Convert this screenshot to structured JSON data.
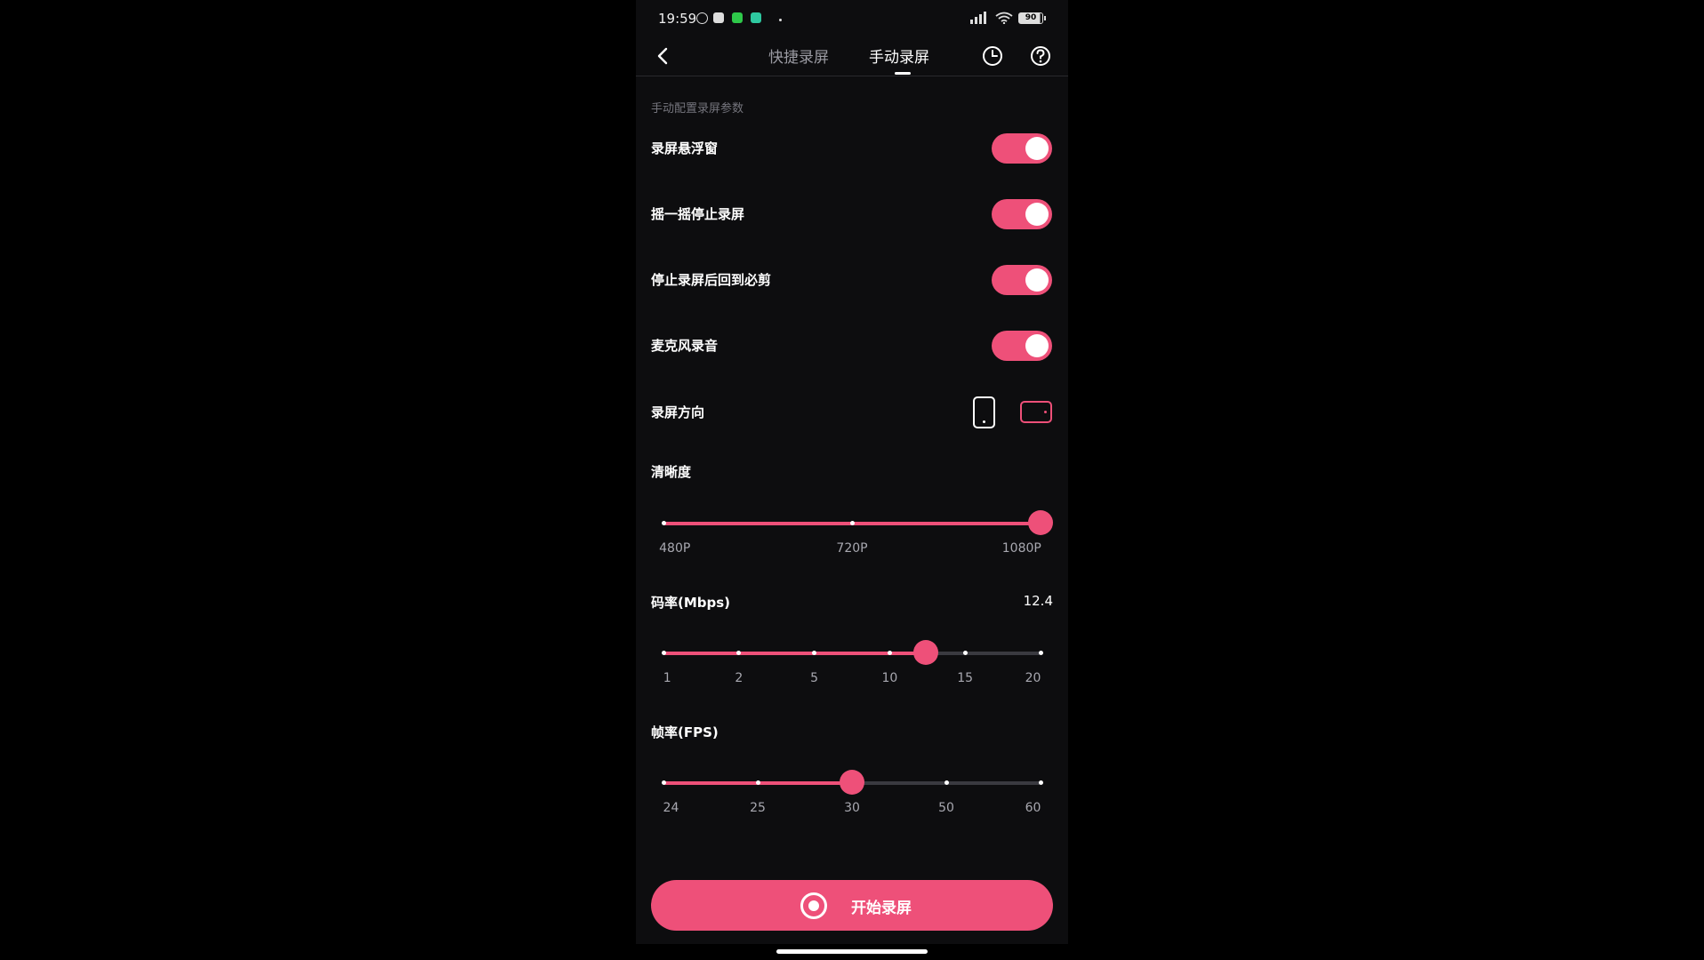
{
  "status_bar": {
    "time": "19:59",
    "battery": "90"
  },
  "header": {
    "tabs": [
      {
        "label": "快捷录屏",
        "active": false
      },
      {
        "label": "手动录屏",
        "active": true
      }
    ]
  },
  "section_label": "手动配置录屏参数",
  "toggles": [
    {
      "label": "录屏悬浮窗",
      "on": true
    },
    {
      "label": "摇一摇停止录屏",
      "on": true
    },
    {
      "label": "停止录屏后回到必剪",
      "on": true
    },
    {
      "label": "麦克风录音",
      "on": true
    }
  ],
  "orientation": {
    "label": "录屏方向",
    "selected": "landscape"
  },
  "resolution": {
    "label": "清晰度",
    "ticks": [
      "480P",
      "720P",
      "1080P"
    ],
    "selected": "1080P"
  },
  "bitrate": {
    "label": "码率(Mbps)",
    "value": "12.4",
    "ticks": [
      "1",
      "2",
      "5",
      "10",
      "15",
      "20"
    ]
  },
  "framerate": {
    "label": "帧率(FPS)",
    "ticks": [
      "24",
      "25",
      "30",
      "50",
      "60"
    ],
    "selected": "30"
  },
  "start_button": {
    "label": "开始录屏"
  },
  "colors": {
    "accent": "#ee5079",
    "background": "#0d0d0f"
  }
}
